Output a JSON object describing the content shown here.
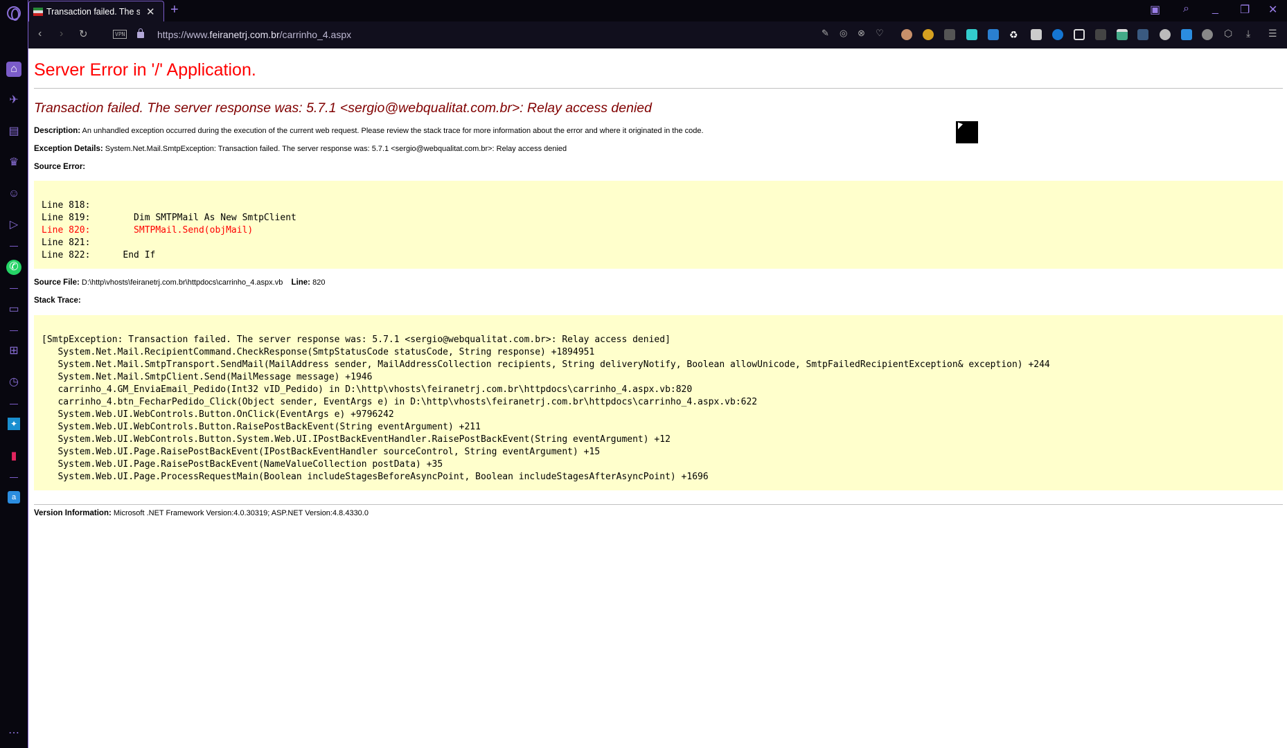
{
  "browser": {
    "tab_title": "Transaction failed. The serv",
    "url_prefix": "https://www.",
    "url_domain": "feiranetrj.com.br",
    "url_path": "/carrinho_4.aspx",
    "vpn_label": "VPN"
  },
  "page": {
    "title": "Server Error in '/' Application.",
    "error_heading": "Transaction failed. The server response was: 5.7.1 <sergio@webqualitat.com.br>: Relay access denied",
    "description_label": "Description:",
    "description": "An unhandled exception occurred during the execution of the current web request. Please review the stack trace for more information about the error and where it originated in the code.",
    "exception_label": "Exception Details:",
    "exception": "System.Net.Mail.SmtpException: Transaction failed. The server response was: 5.7.1 <sergio@webqualitat.com.br>: Relay access denied",
    "source_error_label": "Source Error:",
    "source_lines": [
      "Line 818:",
      "Line 819:        Dim SMTPMail As New SmtpClient",
      "Line 820:        SMTPMail.Send(objMail)",
      "Line 821:",
      "Line 822:      End If"
    ],
    "source_file_label": "Source File:",
    "source_file": "D:\\http\\vhosts\\feiranetrj.com.br\\httpdocs\\carrinho_4.aspx.vb",
    "line_label": "Line:",
    "line": "820",
    "stack_trace_label": "Stack Trace:",
    "stack_trace": [
      "[SmtpException: Transaction failed. The server response was: 5.7.1 <sergio@webqualitat.com.br>: Relay access denied]",
      "   System.Net.Mail.RecipientCommand.CheckResponse(SmtpStatusCode statusCode, String response) +1894951",
      "   System.Net.Mail.SmtpTransport.SendMail(MailAddress sender, MailAddressCollection recipients, String deliveryNotify, Boolean allowUnicode, SmtpFailedRecipientException& exception) +244",
      "   System.Net.Mail.SmtpClient.Send(MailMessage message) +1946",
      "   carrinho_4.GM_EnviaEmail_Pedido(Int32 vID_Pedido) in D:\\http\\vhosts\\feiranetrj.com.br\\httpdocs\\carrinho_4.aspx.vb:820",
      "   carrinho_4.btn_FecharPedido_Click(Object sender, EventArgs e) in D:\\http\\vhosts\\feiranetrj.com.br\\httpdocs\\carrinho_4.aspx.vb:622",
      "   System.Web.UI.WebControls.Button.OnClick(EventArgs e) +9796242",
      "   System.Web.UI.WebControls.Button.RaisePostBackEvent(String eventArgument) +211",
      "   System.Web.UI.WebControls.Button.System.Web.UI.IPostBackEventHandler.RaisePostBackEvent(String eventArgument) +12",
      "   System.Web.UI.Page.RaisePostBackEvent(IPostBackEventHandler sourceControl, String eventArgument) +15",
      "   System.Web.UI.Page.RaisePostBackEvent(NameValueCollection postData) +35",
      "   System.Web.UI.Page.ProcessRequestMain(Boolean includeStagesBeforeAsyncPoint, Boolean includeStagesAfterAsyncPoint) +1696"
    ],
    "version_label": "Version Information:",
    "version": "Microsoft .NET Framework Version:4.0.30319; ASP.NET Version:4.8.4330.0"
  }
}
